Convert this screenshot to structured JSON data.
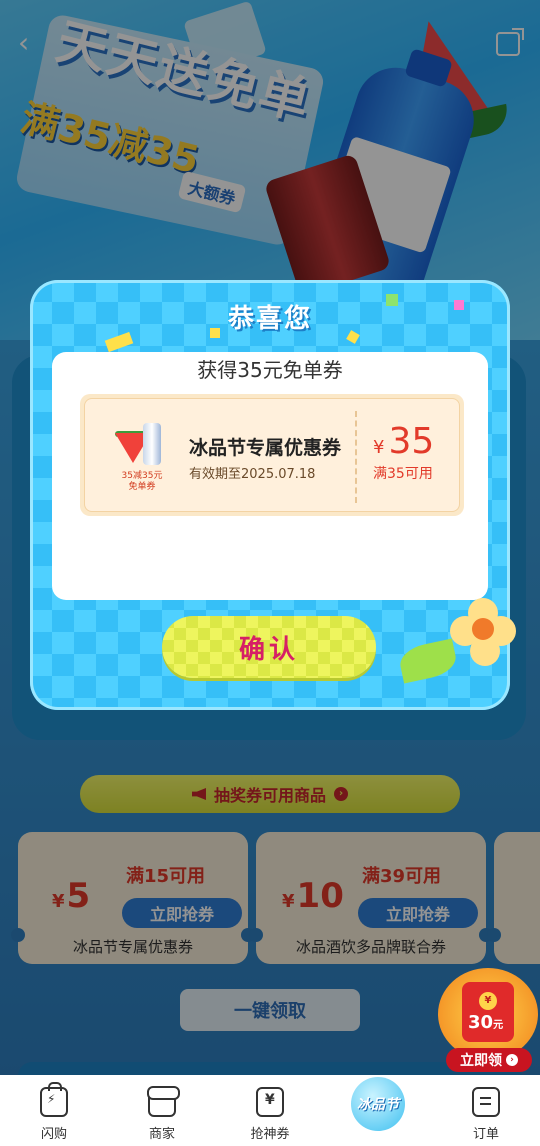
{
  "hero": {
    "slogan": "天天送免单",
    "sub_slogan": "满35减35",
    "badge": "大额券"
  },
  "modal": {
    "title": "恭喜您",
    "subtitle": "获得35元免单券",
    "coupon": {
      "image_label": "35减35元\n免单券",
      "name": "冰品节专属优惠券",
      "validity": "有效期至2025.07.18",
      "currency": "¥",
      "amount": "35",
      "condition": "满35可用"
    },
    "confirm_label": "确认"
  },
  "hint_bar": {
    "label": "抽奖券可用商品"
  },
  "coupons": [
    {
      "currency": "¥",
      "amount": "5",
      "condition": "满15可用",
      "button": "立即抢券",
      "name": "冰品节专属优惠券"
    },
    {
      "currency": "¥",
      "amount": "10",
      "condition": "满39可用",
      "button": "立即抢券",
      "name": "冰品酒饮多品牌联合券"
    }
  ],
  "onekey_label": "一键领取",
  "red_packet": {
    "coin": "¥",
    "amount": "30",
    "unit": "元",
    "button": "立即领"
  },
  "tabbar": {
    "items": [
      {
        "label": "闪购",
        "icon": "shopping-bag-icon"
      },
      {
        "label": "商家",
        "icon": "shop-icon"
      },
      {
        "label": "抢神券",
        "icon": "ticket-icon"
      },
      {
        "label": "冰品节",
        "icon": "ice-festival-icon"
      },
      {
        "label": "订单",
        "icon": "order-icon"
      }
    ]
  },
  "colors": {
    "accent_red": "#e23a2a",
    "modal_blue": "#4fd0ff",
    "confirm_yellow": "#eef55e",
    "confirm_text": "#d61f66"
  }
}
